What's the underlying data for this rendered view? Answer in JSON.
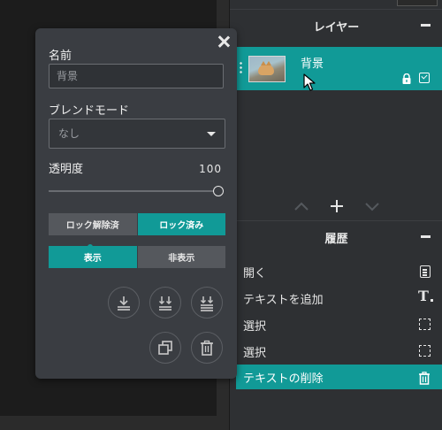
{
  "layers_panel": {
    "title": "レイヤー",
    "layers": [
      {
        "name": "背景",
        "thumbnail": "cat-thumbnail",
        "locked": true,
        "visible": true
      }
    ],
    "controls": [
      "move-up-icon",
      "add-icon",
      "move-down-icon"
    ]
  },
  "history_panel": {
    "title": "履歴",
    "items": [
      {
        "label": "開く",
        "icon": "document-icon"
      },
      {
        "label": "テキストを追加",
        "icon": "text-tool-icon"
      },
      {
        "label": "選択",
        "icon": "selection-icon"
      },
      {
        "label": "選択",
        "icon": "selection-icon"
      },
      {
        "label": "テキストの削除",
        "icon": "trash-icon",
        "active": true
      }
    ]
  },
  "properties": {
    "name_label": "名前",
    "name_value": "背景",
    "blend_label": "ブレンドモード",
    "blend_value": "なし",
    "opacity_label": "透明度",
    "opacity_value": "100",
    "lock_options": [
      "ロック解除済",
      "ロック済み"
    ],
    "lock_selected": "ロック済み",
    "visibility_options": [
      "表示",
      "非表示"
    ],
    "visibility_selected": "表示",
    "actions_row1": [
      "merge-down-icon",
      "merge-visible-icon",
      "merge-all-icon"
    ],
    "actions_row2": [
      "duplicate-icon",
      "delete-icon"
    ]
  },
  "colors": {
    "accent": "#119a97",
    "panel_bg": "#2e3033",
    "popup_bg": "#3a3d42"
  }
}
